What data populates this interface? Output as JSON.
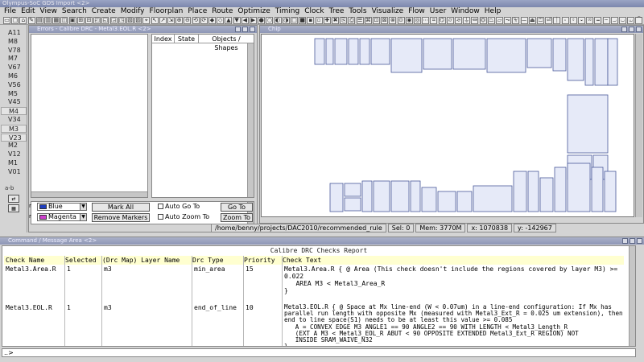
{
  "window": {
    "title": "Olympus-SoC  GDS Import <2>"
  },
  "menu": [
    "File",
    "Edit",
    "View",
    "Search",
    "Create",
    "Modify",
    "Floorplan",
    "Place",
    "Route",
    "Optimize",
    "Timing",
    "Clock",
    "Tree",
    "Tools",
    "Visualize",
    "Flow",
    "User",
    "Window",
    "Help"
  ],
  "layers": [
    "A11",
    "M8",
    "V78",
    "M7",
    "V67",
    "M6",
    "V56",
    "M5",
    "V45",
    "M4",
    "V34",
    "M3",
    "V23",
    "M2",
    "V12",
    "M1",
    "V01"
  ],
  "layer_ab": "a-b",
  "drc_window": {
    "title": "Errors - Calibre DRC - Metal3.EOL.R <2>",
    "columns": [
      "Index",
      "State",
      "Objects / Shapes"
    ],
    "color1": {
      "prefix": "r",
      "name": "Blue",
      "hex": "#1f3fbf"
    },
    "color2": {
      "prefix": "r",
      "name": "Magenta",
      "hex": "#d040d0"
    },
    "mark_all": "Mark All",
    "remove_markers": "Remove Markers",
    "auto_goto": "Auto Go To",
    "auto_zoom": "Auto Zoom To",
    "goto": "Go To",
    "zoom_to": "Zoom To"
  },
  "layout_window": {
    "title": "Chip"
  },
  "status": {
    "path": "/home/benny/projects/DAC2010/recommended_rule",
    "sel": "Sel: 0",
    "mem": "Mem: 3770M",
    "x": "x: 1070838",
    "y": "y: -142967"
  },
  "message_window": {
    "title": "Command / Message Area <2>",
    "report_title": "Calibre DRC Checks Report",
    "columns": [
      "Check Name",
      "Selected",
      "(Drc Map) Layer Name",
      "Drc Type",
      "Priority",
      "Check Text"
    ],
    "rows": [
      {
        "name": "Metal3.Area.R",
        "selected": "1",
        "layer": "m3",
        "type": "min_area",
        "priority": "15",
        "text": "Metal3.Area.R { @ Area (This check doesn't include the regions covered by layer M3) >= 0.022\n   AREA M3 < Metal3_Area_R\n}"
      },
      {
        "name": "Metal3.EOL.R",
        "selected": "1",
        "layer": "m3",
        "type": "end_of_line",
        "priority": "10",
        "text": "Metal3.EOL.R { @ Space at Mx line-end (W < 0.07um) in a line-end configuration: If Mx has parallel run length with opposite Mx (measured with Metal3_Ext_R = 0.025 um extension), then end to line space(S1) needs to be at least this value >= 0.085\n   A = CONVEX EDGE M3 ANGLE1 == 90 ANGLE2 == 90 WITH LENGTH < Metal3_Length_R\n   (EXT A M3 < Metal3_EOL_R ABUT < 90 OPPOSITE EXTENDED Metal3_Ext_R REGION) NOT\n   INSIDE SRAM_WAIVE_N32\n}"
      }
    ],
    "prompt": "..>"
  }
}
